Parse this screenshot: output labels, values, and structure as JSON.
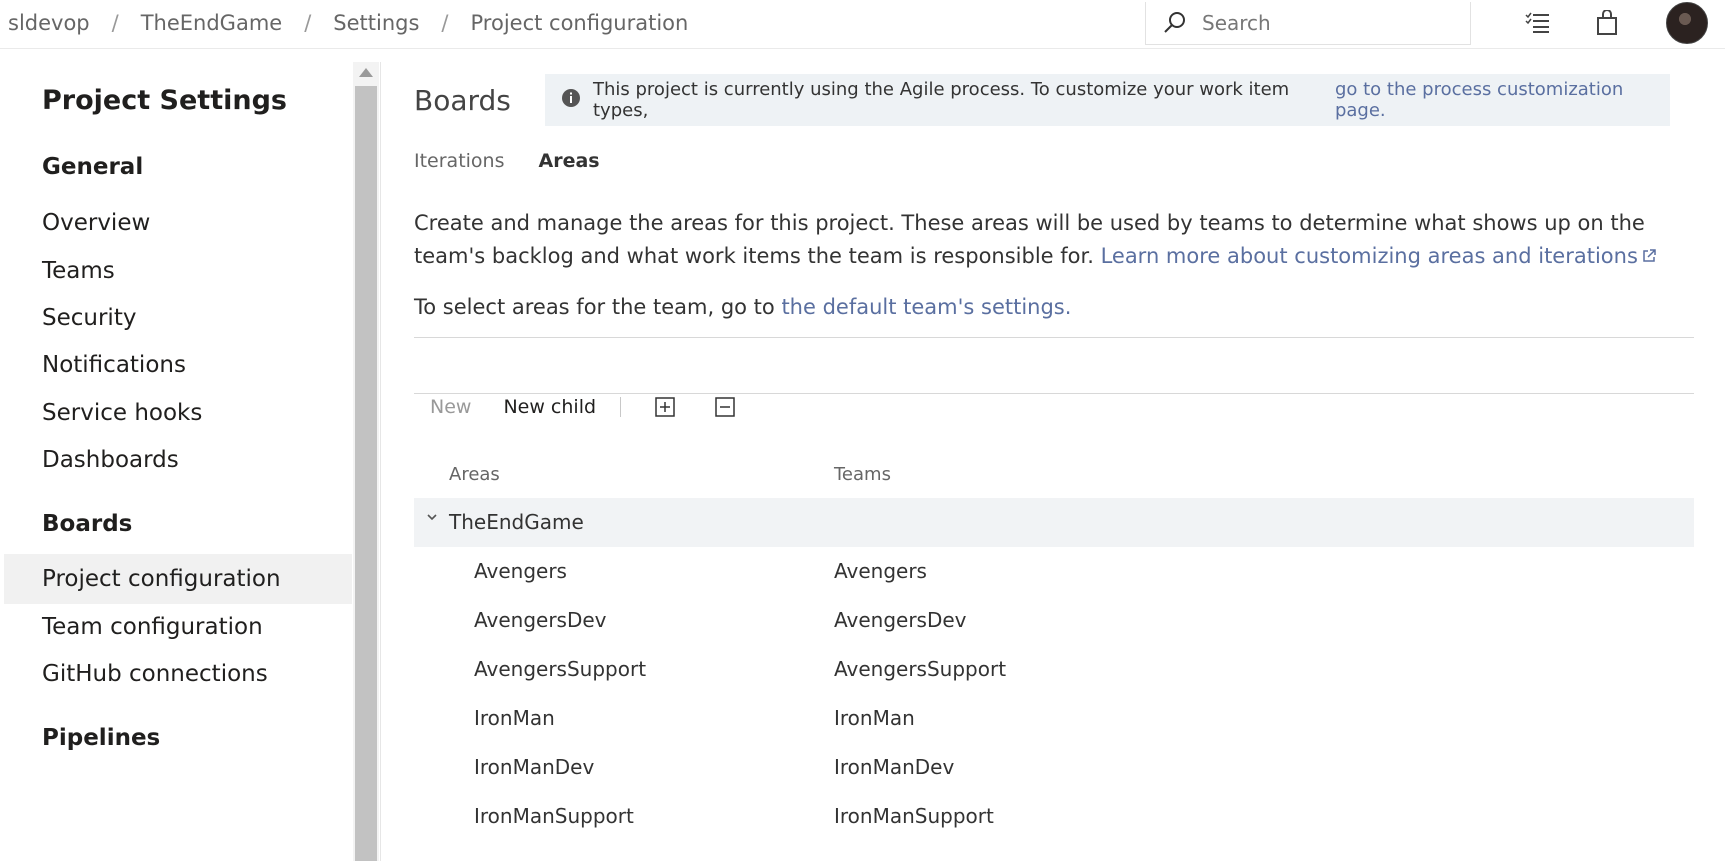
{
  "breadcrumb": [
    "sldevop",
    "TheEndGame",
    "Settings",
    "Project configuration"
  ],
  "breadcrumb_separator": "/",
  "search": {
    "placeholder": "Search"
  },
  "sidebar": {
    "title": "Project Settings",
    "sections": [
      {
        "title": "General",
        "items": [
          "Overview",
          "Teams",
          "Security",
          "Notifications",
          "Service hooks",
          "Dashboards"
        ]
      },
      {
        "title": "Boards",
        "items": [
          "Project configuration",
          "Team configuration",
          "GitHub connections"
        ]
      },
      {
        "title": "Pipelines",
        "items": []
      }
    ],
    "selected": "Project configuration"
  },
  "main": {
    "title": "Boards",
    "info": {
      "text": "This project is currently using the Agile process. To customize your work item types, ",
      "link": "go to the process customization page."
    },
    "tabs": [
      {
        "label": "Iterations",
        "active": false
      },
      {
        "label": "Areas",
        "active": true
      }
    ],
    "description": "Create and manage the areas for this project. These areas will be used by teams to determine what shows up on the team's backlog and what work items the team is responsible for. ",
    "learn_more": "Learn more about customizing areas and iterations",
    "select_text": "To select areas for the team, go to ",
    "select_link": "the default team's settings.",
    "toolbar": {
      "new": "New",
      "new_child": "New child"
    },
    "grid": {
      "headers": {
        "areas": "Areas",
        "teams": "Teams"
      },
      "root": "TheEndGame",
      "rows": [
        {
          "area": "Avengers",
          "team": "Avengers"
        },
        {
          "area": "AvengersDev",
          "team": "AvengersDev"
        },
        {
          "area": "AvengersSupport",
          "team": "AvengersSupport"
        },
        {
          "area": "IronMan",
          "team": "IronMan"
        },
        {
          "area": "IronManDev",
          "team": "IronManDev"
        },
        {
          "area": "IronManSupport",
          "team": "IronManSupport"
        }
      ]
    }
  },
  "colors": {
    "link": "#5a6fa0",
    "selected_bg": "#f1f1f1",
    "info_bg": "#eef2f5"
  }
}
